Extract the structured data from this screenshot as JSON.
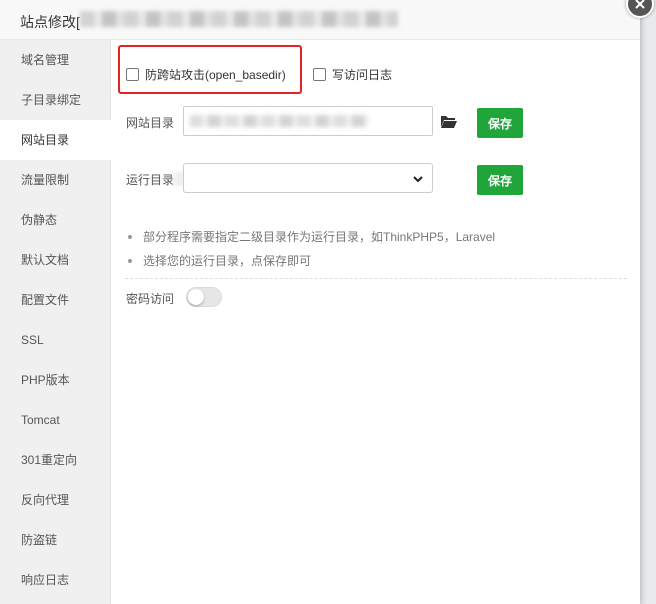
{
  "dialog": {
    "title": "站点修改["
  },
  "sidebar": {
    "items": [
      {
        "label": "域名管理"
      },
      {
        "label": "子目录绑定"
      },
      {
        "label": "网站目录",
        "active": true
      },
      {
        "label": "流量限制"
      },
      {
        "label": "伪静态"
      },
      {
        "label": "默认文档"
      },
      {
        "label": "配置文件"
      },
      {
        "label": "SSL"
      },
      {
        "label": "PHP版本"
      },
      {
        "label": "Tomcat"
      },
      {
        "label": "301重定向"
      },
      {
        "label": "反向代理"
      },
      {
        "label": "防盗链"
      },
      {
        "label": "响应日志"
      }
    ]
  },
  "main": {
    "anti_xss_label": "防跨站攻击(open_basedir)",
    "write_log_label": "写访问日志",
    "site_dir_label": "网站目录",
    "run_dir_label": "运行目录",
    "run_dir_value": "",
    "save_label": "保存",
    "tips": [
      "部分程序需要指定二级目录作为运行目录，如ThinkPHP5，Laravel",
      "选择您的运行目录，点保存即可"
    ],
    "password_access_label": "密码访问",
    "password_access_on": false
  },
  "colors": {
    "accent": "#20a53a",
    "highlight": "#e02424",
    "sidebar_bg": "#f0f0f0"
  },
  "icons": {
    "folder": "folder-open-icon",
    "close": "close-icon",
    "chevron": "chevron-down-icon"
  }
}
